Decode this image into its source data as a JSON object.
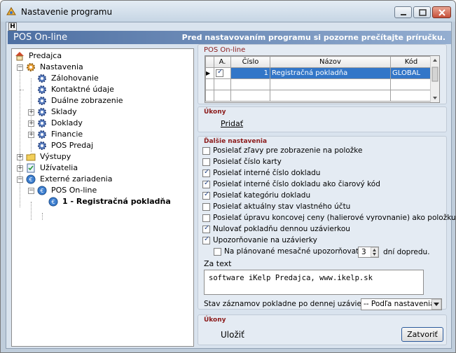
{
  "window": {
    "title": "Nastavenie programu"
  },
  "help_button": "H",
  "banner": {
    "product": "POS On-line",
    "note": "Pred nastavovaním programu si pozorne prečítajte príručku."
  },
  "tree": {
    "root": "Predajca",
    "settings": "Nastavenia",
    "backup": "Zálohovanie",
    "contacts": "Kontaktné údaje",
    "dual_display": "Duálne zobrazenie",
    "stores": "Sklady",
    "documents": "Doklady",
    "finance": "Financie",
    "pos_sale": "POS Predaj",
    "outputs": "Výstupy",
    "users": "Užívatelia",
    "external": "Externé zariadenia",
    "pos_online": "POS On-line",
    "register": "1 - Registračná pokladňa"
  },
  "pos_group": {
    "title": "POS On-line",
    "columns": [
      "A.",
      "Číslo",
      "Názov",
      "Kód"
    ],
    "rows": [
      {
        "active": true,
        "number": "1",
        "name": "Registračná pokladňa",
        "code": "GLOBAL"
      }
    ]
  },
  "actions_group": {
    "title": "Úkony",
    "add": "Pridať"
  },
  "more_group": {
    "title": "Ďalšie nastavenia",
    "options": [
      {
        "label": "Posielať zľavy pre zobrazenie na položke",
        "checked": false
      },
      {
        "label": "Posielať číslo karty",
        "checked": false
      },
      {
        "label": "Posielať interné číslo dokladu",
        "checked": true
      },
      {
        "label": "Posielať interné číslo dokladu ako čiarový kód",
        "checked": true
      },
      {
        "label": "Posielať kategóriu dokladu",
        "checked": true
      },
      {
        "label": "Posielať aktuálny stav vlastného účtu",
        "checked": false
      },
      {
        "label": "Posielať úpravu koncovej ceny (halierové vyrovnanie) ako položku",
        "checked": false
      },
      {
        "label": "Nulovať pokladňu dennou uzávierkou",
        "checked": true
      },
      {
        "label": "Upozorňovanie na uzávierky",
        "checked": true
      }
    ],
    "planned_label": "Na plánované mesačné upozorňovať*",
    "planned_checked": false,
    "planned_days": "3",
    "planned_suffix": "dní dopredu.",
    "za_text_label": "Za text",
    "za_text_value": "software iKelp Predajca, www.ikelp.sk",
    "state_label": "Stav záznamov pokladne po dennej uzávierke",
    "state_value": "-- Podľa nastavenia"
  },
  "footer_group": {
    "title": "Úkony",
    "save": "Uložiť",
    "close": "Zatvoriť"
  },
  "colors": {
    "banner": "#4d6fa2",
    "selection": "#3276c8",
    "group_title": "#8b1a1a"
  }
}
